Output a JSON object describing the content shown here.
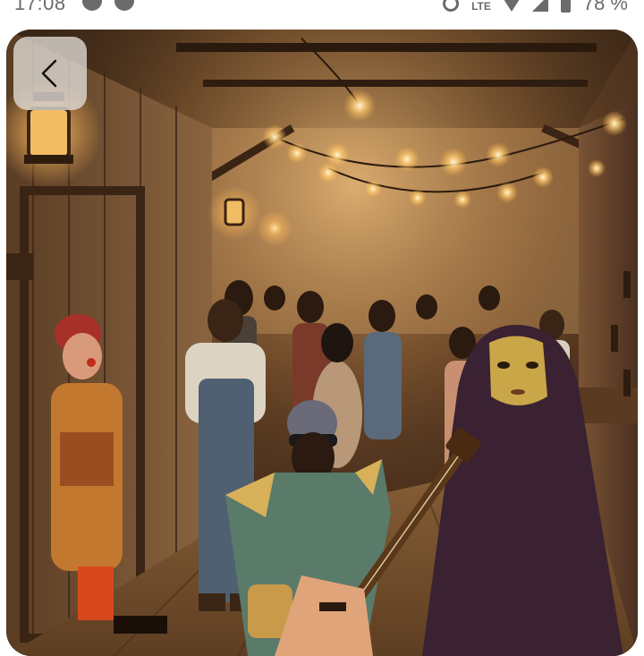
{
  "status_bar": {
    "time": "17:08",
    "network": "LTE",
    "battery": "78 %"
  },
  "viewer": {
    "back_icon": "chevron-left-icon"
  },
  "colors": {
    "background": "#ffffff",
    "status_text": "#6b6b6b",
    "back_button_bg": "#e1ded8"
  }
}
